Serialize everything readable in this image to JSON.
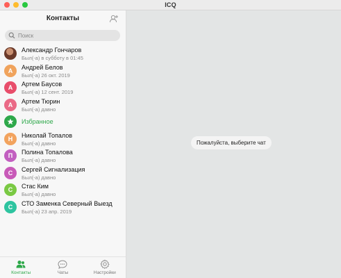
{
  "window": {
    "title": "ICQ"
  },
  "sidebar": {
    "title": "Контакты",
    "search_placeholder": "Поиск",
    "search_value": ""
  },
  "contacts": [
    {
      "name": "Александр Гончаров",
      "status": "Был(-а) в субботу в 01:45",
      "avatar": "photo",
      "color": "#6b4a3a"
    },
    {
      "name": "Андрей Белов",
      "status": "Был(-а) 26 окт. 2019",
      "avatar": "А",
      "color": "#f0a35c"
    },
    {
      "name": "Артем Баусов",
      "status": "Был(-а) 12 сент. 2019",
      "avatar": "А",
      "color": "#e84d6a"
    },
    {
      "name": "Артем Тюрин",
      "status": "Был(-а) давно",
      "avatar": "А",
      "color": "#ea6a86"
    },
    {
      "name": "Избранное",
      "status": "",
      "avatar": "star",
      "color": "#2ea84a"
    },
    {
      "name": "Николай Топалов",
      "status": "Был(-а) давно",
      "avatar": "Н",
      "color": "#f2a35e"
    },
    {
      "name": "Полина Топалова",
      "status": "Был(-а) давно",
      "avatar": "П",
      "color": "#c25fc0"
    },
    {
      "name": "Сергей Сигнализация",
      "status": "Был(-а) давно",
      "avatar": "С",
      "color": "#c85ab8"
    },
    {
      "name": "Стас Ким",
      "status": "Был(-а) давно",
      "avatar": "С",
      "color": "#7ac943"
    },
    {
      "name": "СТО Заменка Северный Выезд",
      "status": "Был(-а) 23 апр. 2019",
      "avatar": "С",
      "color": "#2ec4a0"
    }
  ],
  "tabs": [
    {
      "label": "Контакты",
      "icon": "contacts-icon",
      "active": true
    },
    {
      "label": "Чаты",
      "icon": "chats-icon",
      "active": false
    },
    {
      "label": "Настройки",
      "icon": "settings-icon",
      "active": false
    }
  ],
  "main": {
    "empty_hint": "Пожалуйста, выберите чат"
  },
  "colors": {
    "accent": "#2ea84a"
  }
}
